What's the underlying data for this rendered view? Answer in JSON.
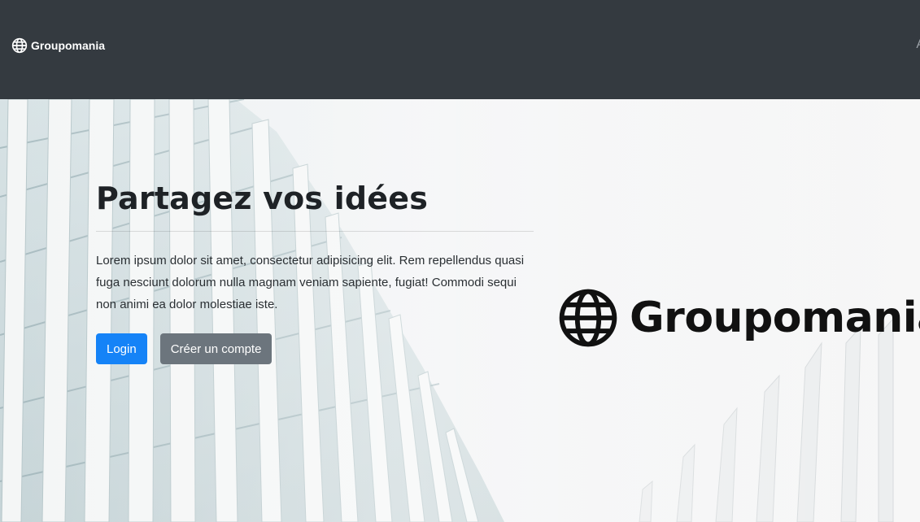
{
  "navbar": {
    "brand": "Groupomania",
    "brand_icon": "globe-icon",
    "background": "#343a40"
  },
  "hero": {
    "title": "Partagez vos idées",
    "lead": "Lorem ipsum dolor sit amet, consectetur adipisicing elit. Rem repellendus quasi fuga nesciunt dolorum nulla magnam veniam sapiente, fugiat! Commodi sequi non animi ea dolor molestiae iste.",
    "login_label": "Login",
    "signup_label": "Créer un compte",
    "logo_text": "Groupomania",
    "logo_icon": "globe-icon"
  },
  "colors": {
    "primary": "#1583f7",
    "secondary": "#6c757d"
  }
}
